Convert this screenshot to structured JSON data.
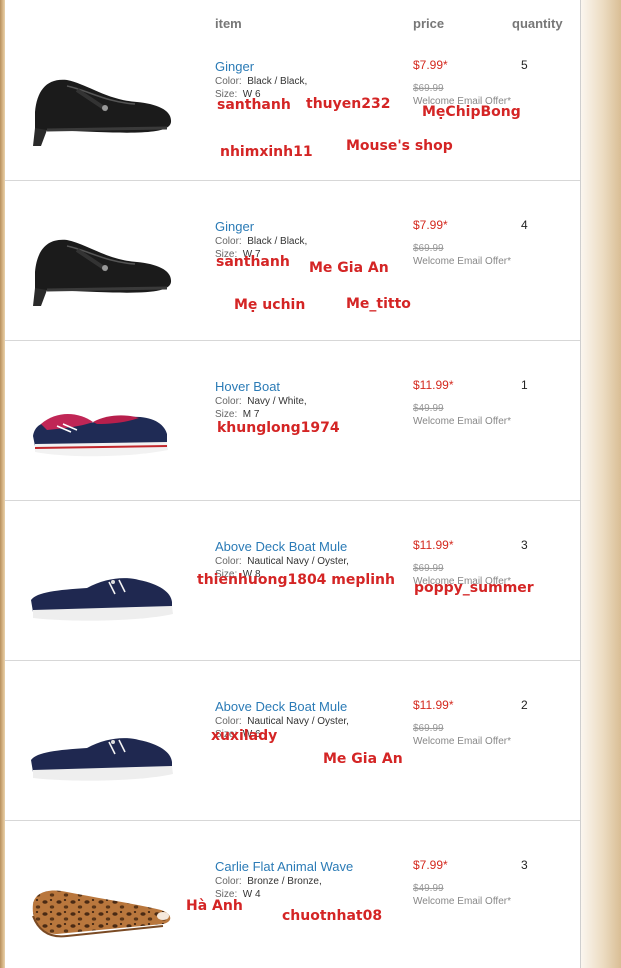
{
  "header": {
    "item": "item",
    "price": "price",
    "quantity": "quantity"
  },
  "labels": {
    "color": "Color:",
    "size": "Size:"
  },
  "items": [
    {
      "name": "Ginger",
      "color": "Black / Black,",
      "size": "W 6",
      "price": "$7.99*",
      "old_price": "$69.99",
      "offer": "Welcome Email Offer*",
      "quantity": "5",
      "shoe_icon": "black-mary-jane-wedge-icon",
      "tags": [
        "santhanh",
        "thuyen232",
        "MẹChipBong",
        "nhimxinh11",
        "Mouse's shop"
      ]
    },
    {
      "name": "Ginger",
      "color": "Black / Black,",
      "size": "W 7",
      "price": "$7.99*",
      "old_price": "$69.99",
      "offer": "Welcome Email Offer*",
      "quantity": "4",
      "shoe_icon": "black-mary-jane-wedge-icon",
      "tags": [
        "santhanh",
        "Me Gia An",
        "Mẹ uchin",
        "Me_titto"
      ]
    },
    {
      "name": "Hover Boat",
      "color": "Navy / White,",
      "size": "M 7",
      "price": "$11.99*",
      "old_price": "$49.99",
      "offer": "Welcome Email Offer*",
      "quantity": "1",
      "shoe_icon": "navy-red-boat-shoe-icon",
      "tags": [
        "khunglong1974"
      ]
    },
    {
      "name": "Above Deck Boat Mule",
      "color": "Nautical Navy / Oyster,",
      "size": "W 8",
      "price": "$11.99*",
      "old_price": "$69.99",
      "offer": "Welcome Email Offer*",
      "quantity": "3",
      "shoe_icon": "navy-boat-mule-icon",
      "tags": [
        "thienhuong1804  meplinh",
        "poppy_summer"
      ]
    },
    {
      "name": "Above Deck Boat Mule",
      "color": "Nautical Navy / Oyster,",
      "size": "W 6",
      "price": "$11.99*",
      "old_price": "$69.99",
      "offer": "Welcome Email Offer*",
      "quantity": "2",
      "shoe_icon": "navy-boat-mule-icon",
      "tags": [
        "xuxilady",
        "Me Gia An"
      ]
    },
    {
      "name": "Carlie Flat Animal Wave",
      "color": "Bronze / Bronze,",
      "size": "W 4",
      "price": "$7.99*",
      "old_price": "$49.99",
      "offer": "Welcome Email Offer*",
      "quantity": "3",
      "shoe_icon": "leopard-peep-toe-flat-icon",
      "tags": [
        "Hà Anh",
        "chuotnhat08"
      ]
    }
  ],
  "colors": {
    "link_blue": "#2b7bb6",
    "price_red": "#d42a1f",
    "tag_red": "#d42525"
  }
}
